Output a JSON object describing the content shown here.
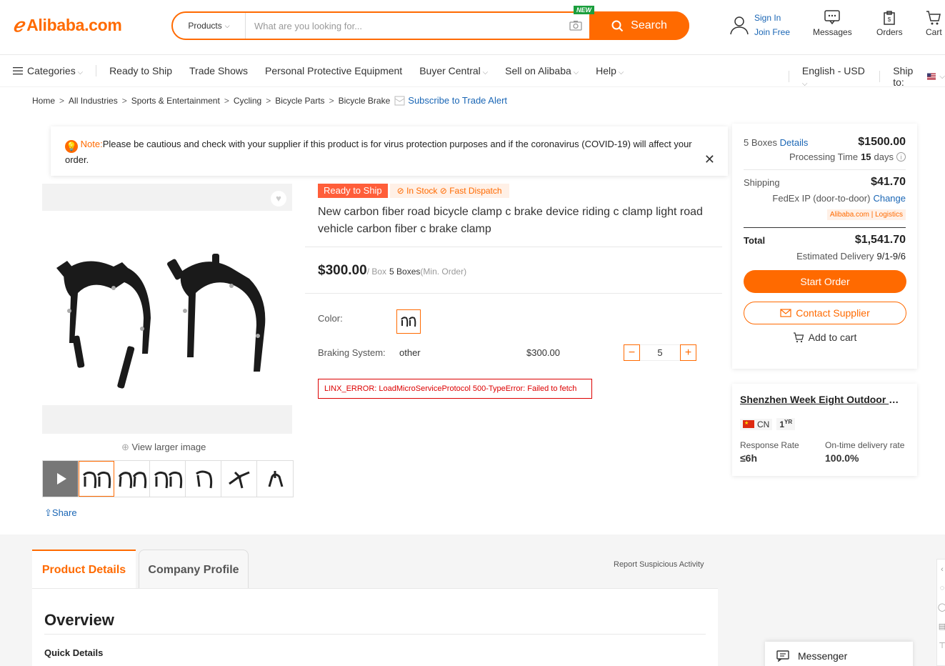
{
  "header": {
    "logo_text": "Alibaba.com",
    "search_category": "Products",
    "search_placeholder": "What are you looking for...",
    "new_badge": "NEW",
    "search_button": "Search",
    "sign_in": "Sign In",
    "join_free": "Join Free",
    "messages": "Messages",
    "orders": "Orders",
    "cart": "Cart"
  },
  "nav": {
    "categories": "Categories",
    "items": [
      "Ready to Ship",
      "Trade Shows",
      "Personal Protective Equipment",
      "Buyer Central",
      "Sell on Alibaba",
      "Help"
    ],
    "language": "English - USD",
    "ship_to": "Ship to:"
  },
  "breadcrumb": {
    "items": [
      "Home",
      "All Industries",
      "Sports & Entertainment",
      "Cycling",
      "Bicycle Parts",
      "Bicycle Brake"
    ],
    "subscribe": "Subscribe to Trade Alert"
  },
  "note": {
    "label": "Note:",
    "text": "Please be cautious and check with your supplier if this product is for virus protection purposes and if the coronavirus (COVID-19) will affect your order."
  },
  "gallery": {
    "view_larger": "View larger image",
    "share": "Share"
  },
  "product": {
    "ready_badge": "Ready to Ship",
    "stock": "In Stock",
    "dispatch": "Fast Dispatch",
    "title": "New carbon fiber road bicycle clamp c brake device riding c clamp light road vehicle carbon fiber c brake clamp",
    "price": "$300.00",
    "unit": "/ Box",
    "min_qty": "5 Boxes",
    "min_label": "(Min. Order)",
    "color_label": "Color:",
    "braking_label": "Braking System:",
    "braking_value": "other",
    "variant_price": "$300.00",
    "quantity": "5",
    "error": "LINX_ERROR: LoadMicroServiceProtocol 500-TypeError: Failed to fetch"
  },
  "order": {
    "qty_text": "5 Boxes",
    "details": "Details",
    "subtotal": "$1500.00",
    "processing_label": "Processing Time",
    "processing_days": "15",
    "days": "days",
    "shipping_label": "Shipping",
    "shipping_cost": "$41.70",
    "carrier": "FedEx IP (door-to-door)",
    "change": "Change",
    "logistics": "Alibaba.com | Logistics",
    "total_label": "Total",
    "total": "$1,541.70",
    "delivery_label": "Estimated Delivery",
    "delivery_dates": "9/1-9/6",
    "start_order": "Start Order",
    "contact": "Contact Supplier",
    "add_cart": "Add to cart"
  },
  "supplier": {
    "name": "Shenzhen Week Eight Outdoor Pr...",
    "country": "CN",
    "years": "1",
    "years_unit": "YR",
    "response_label": "Response Rate",
    "response_value": "≤6h",
    "ontime_label": "On-time delivery rate",
    "ontime_value": "100.0%"
  },
  "tabs": {
    "product_details": "Product Details",
    "company_profile": "Company Profile",
    "report": "Report Suspicious Activity"
  },
  "details": {
    "overview": "Overview",
    "quick_details": "Quick Details"
  },
  "messenger": "Messenger",
  "colors": {
    "accent": "#ff6a00",
    "link": "#1a66b5"
  }
}
